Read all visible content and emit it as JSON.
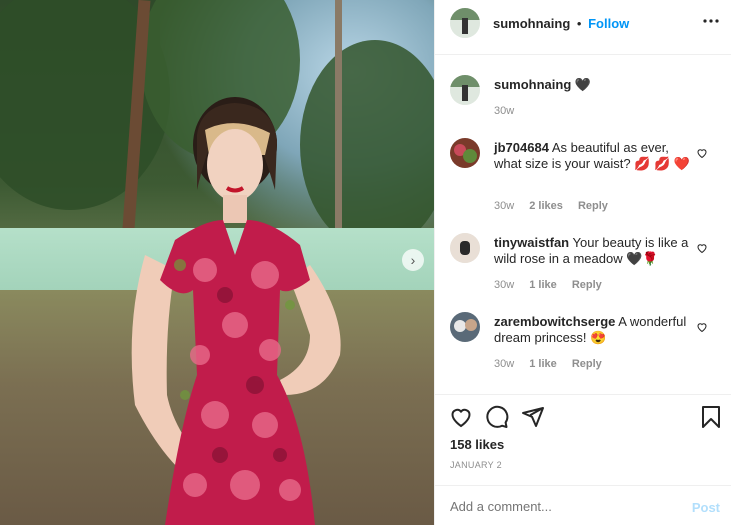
{
  "post": {
    "username": "sumohnaing",
    "follow_label": "Follow",
    "separator": "•",
    "caption": "sumohnaing",
    "caption_emoji": "🖤",
    "caption_age": "30w",
    "likes": "158 likes",
    "date": "JANUARY 2"
  },
  "comments": [
    {
      "user": "jb704684",
      "text": "As beautiful as ever, what size is your waist? 💋 💋 ❤️",
      "age": "30w",
      "likes": "2 likes",
      "reply": "Reply"
    },
    {
      "user": "tinywaistfan",
      "text": "Your beauty is like a wild rose in a meadow 🖤🌹",
      "age": "30w",
      "likes": "1 like",
      "reply": "Reply"
    },
    {
      "user": "zarembowitchserge",
      "text": "A wonderful dream princess! 😍",
      "age": "30w",
      "likes": "1 like",
      "reply": "Reply"
    }
  ],
  "composer": {
    "placeholder": "Add a comment...",
    "post_label": "Post"
  },
  "icons": [
    "more-icon",
    "heart-icon",
    "comment-icon",
    "share-icon",
    "bookmark-icon",
    "next-arrow-icon"
  ]
}
